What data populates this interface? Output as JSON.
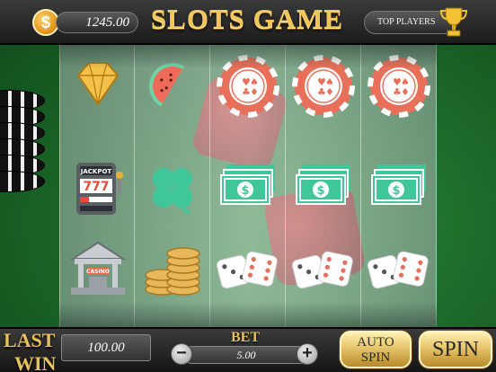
{
  "header": {
    "coin_symbol": "$",
    "balance": "1245.00",
    "title": "SLOTS GAME",
    "top_players_label": "TOP PLAYERS"
  },
  "reels": [
    [
      "diamond-icon",
      "jackpot-machine-icon",
      "casino-building-icon"
    ],
    [
      "watermelon-icon",
      "four-leaf-clover-icon",
      "coin-stack-icon"
    ],
    [
      "poker-chip-icon",
      "dollar-bills-icon",
      "dice-pair-icon"
    ],
    [
      "poker-chip-icon",
      "dollar-bills-icon",
      "dice-pair-icon"
    ],
    [
      "poker-chip-icon",
      "dollar-bills-icon",
      "dice-pair-icon"
    ]
  ],
  "symbol_text": {
    "jackpot": "JACKPOT",
    "sevens": "777",
    "casino": "CASINO"
  },
  "footer": {
    "last_win_label_1": "LAST",
    "last_win_label_2": "WIN",
    "last_win_value": "100.00",
    "bet_label": "BET",
    "bet_value": "5.00",
    "minus_symbol": "−",
    "plus_symbol": "+",
    "auto_spin_label_1": "AUTO",
    "auto_spin_label_2": "SPIN",
    "spin_label": "SPIN"
  },
  "colors": {
    "felt": "#2f8a3a",
    "gold": "#f0c65a",
    "chip_red": "#e8705a",
    "mint": "#3fc79a"
  }
}
